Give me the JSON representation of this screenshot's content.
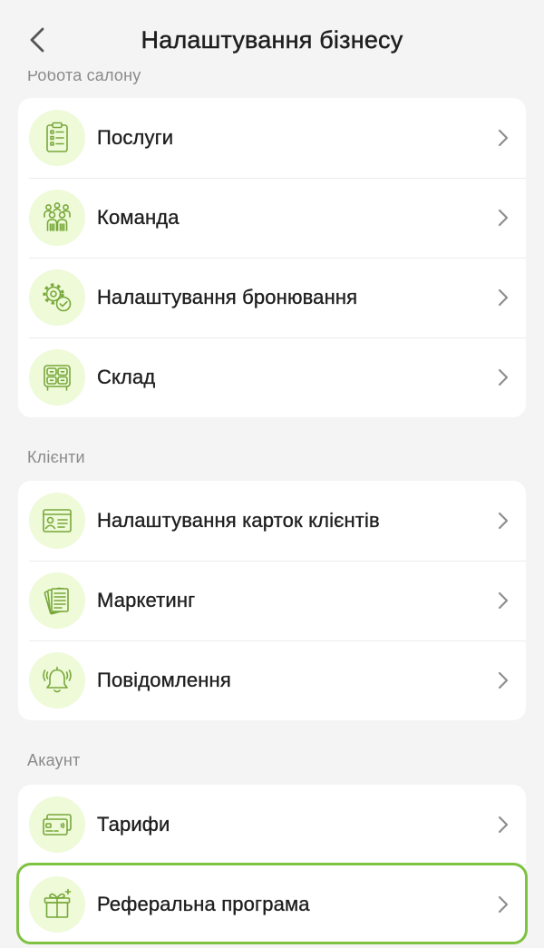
{
  "header": {
    "title": "Налаштування бізнесу",
    "back_icon": "chevron-left-icon"
  },
  "sections": [
    {
      "label": "Робота салону",
      "items": [
        {
          "label": "Послуги",
          "icon": "services-list-icon"
        },
        {
          "label": "Команда",
          "icon": "team-icon"
        },
        {
          "label": "Налаштування бронювання",
          "icon": "booking-settings-icon"
        },
        {
          "label": "Склад",
          "icon": "warehouse-icon"
        }
      ]
    },
    {
      "label": "Клієнти",
      "items": [
        {
          "label": "Налаштування карток клієнтів",
          "icon": "client-card-icon"
        },
        {
          "label": "Маркетинг",
          "icon": "marketing-icon"
        },
        {
          "label": "Повідомлення",
          "icon": "notifications-bell-icon"
        }
      ]
    },
    {
      "label": "Акаунт",
      "items": [
        {
          "label": "Тарифи",
          "icon": "tariffs-card-icon"
        },
        {
          "label": "Реферальна програма",
          "icon": "referral-gift-icon",
          "highlighted": true
        }
      ]
    }
  ],
  "colors": {
    "bg": "#f4f4f4",
    "card": "#ffffff",
    "circle": "#eefad8",
    "stroke": "#78a83b",
    "hl": "#7ec242",
    "text": "#1f1f1f",
    "label": "#8a8a8a",
    "chev": "#8e8e8e"
  }
}
